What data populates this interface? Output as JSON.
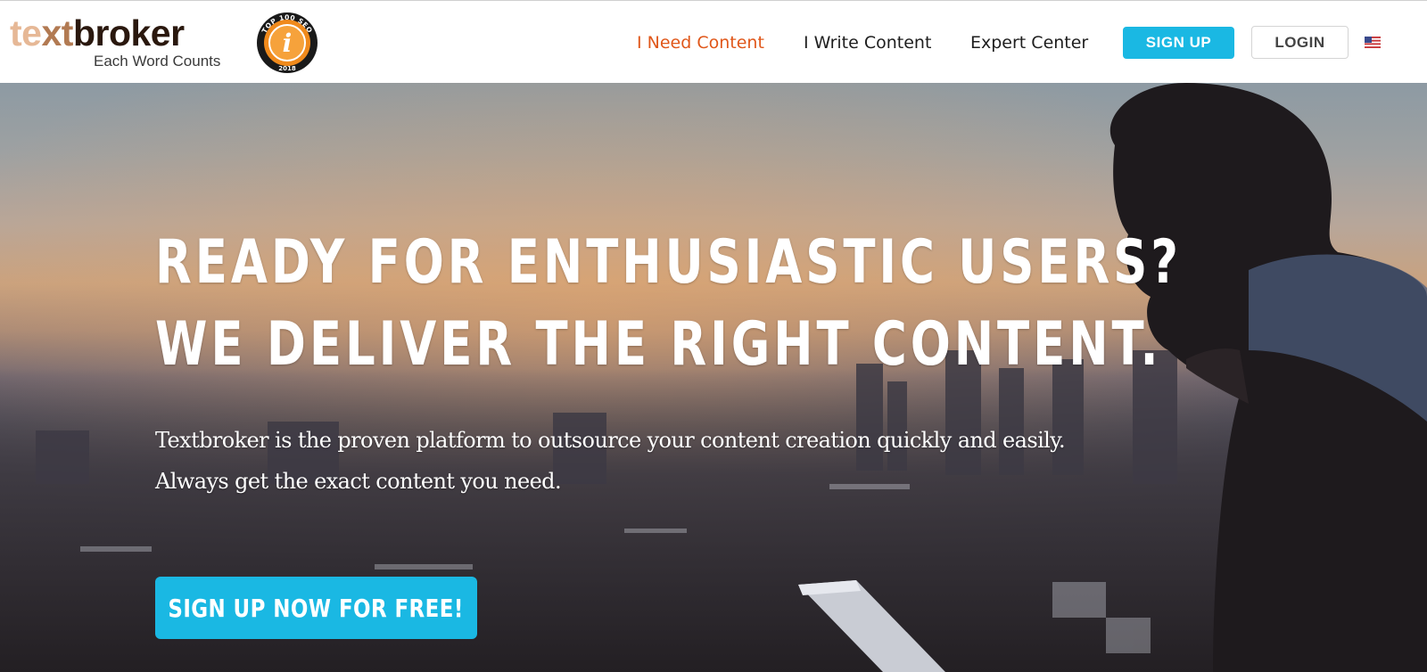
{
  "brand": {
    "logo_text_part1": "te",
    "logo_text_part2": "xt",
    "logo_text_part3": "broker",
    "tagline": "Each Word Counts",
    "seal_text_top": "TOP 100 SEO",
    "seal_text_year": "2018",
    "seal_letter": "i"
  },
  "nav": {
    "items": [
      {
        "label": "I Need Content",
        "active": true
      },
      {
        "label": "I Write Content",
        "active": false
      },
      {
        "label": "Expert Center",
        "active": false
      }
    ],
    "signup_label": "SIGN UP",
    "login_label": "LOGIN",
    "language_icon": "us-flag-icon"
  },
  "hero": {
    "headline_line1": "READY FOR ENTHUSIASTIC USERS?",
    "headline_line2": "WE DELIVER THE RIGHT CONTENT.",
    "subtext_line1": "Textbroker is the proven platform to outsource your content creation quickly and easily.",
    "subtext_line2": "Always get the exact content you need.",
    "cta_label": "SIGN UP NOW FOR FREE!"
  },
  "colors": {
    "accent": "#1ab8e3",
    "active_nav": "#e0571a",
    "text_dark": "#1e1e1e"
  }
}
